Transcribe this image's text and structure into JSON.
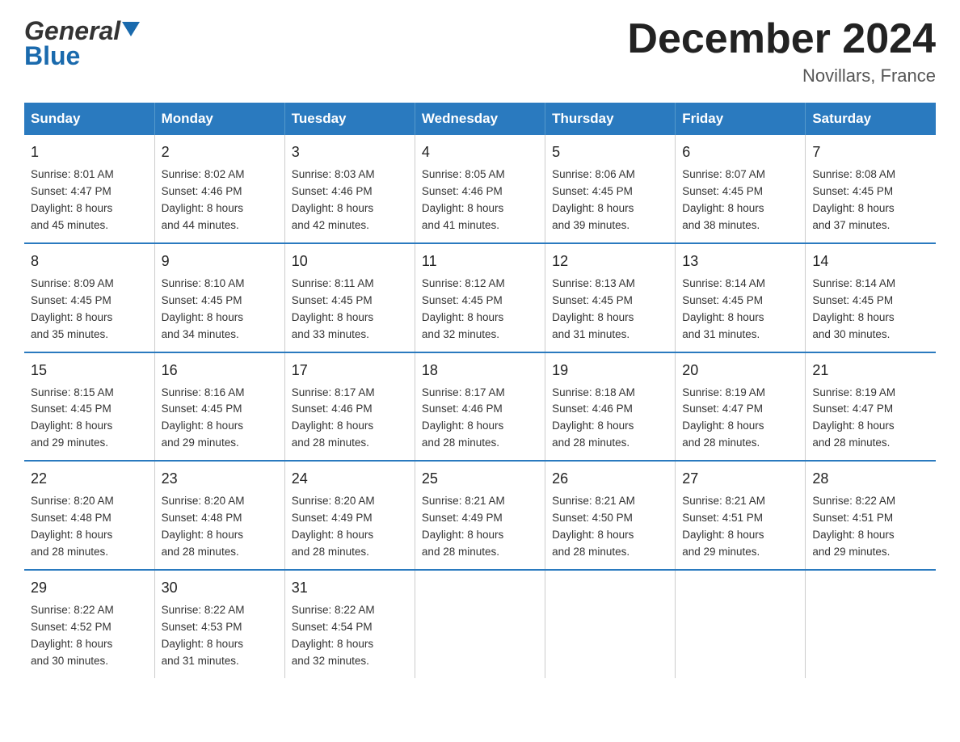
{
  "header": {
    "logo_line1": "General",
    "logo_line2": "Blue",
    "main_title": "December 2024",
    "subtitle": "Novillars, France"
  },
  "days_of_week": [
    "Sunday",
    "Monday",
    "Tuesday",
    "Wednesday",
    "Thursday",
    "Friday",
    "Saturday"
  ],
  "weeks": [
    [
      {
        "day": "1",
        "sunrise": "8:01 AM",
        "sunset": "4:47 PM",
        "daylight": "8 hours and 45 minutes."
      },
      {
        "day": "2",
        "sunrise": "8:02 AM",
        "sunset": "4:46 PM",
        "daylight": "8 hours and 44 minutes."
      },
      {
        "day": "3",
        "sunrise": "8:03 AM",
        "sunset": "4:46 PM",
        "daylight": "8 hours and 42 minutes."
      },
      {
        "day": "4",
        "sunrise": "8:05 AM",
        "sunset": "4:46 PM",
        "daylight": "8 hours and 41 minutes."
      },
      {
        "day": "5",
        "sunrise": "8:06 AM",
        "sunset": "4:45 PM",
        "daylight": "8 hours and 39 minutes."
      },
      {
        "day": "6",
        "sunrise": "8:07 AM",
        "sunset": "4:45 PM",
        "daylight": "8 hours and 38 minutes."
      },
      {
        "day": "7",
        "sunrise": "8:08 AM",
        "sunset": "4:45 PM",
        "daylight": "8 hours and 37 minutes."
      }
    ],
    [
      {
        "day": "8",
        "sunrise": "8:09 AM",
        "sunset": "4:45 PM",
        "daylight": "8 hours and 35 minutes."
      },
      {
        "day": "9",
        "sunrise": "8:10 AM",
        "sunset": "4:45 PM",
        "daylight": "8 hours and 34 minutes."
      },
      {
        "day": "10",
        "sunrise": "8:11 AM",
        "sunset": "4:45 PM",
        "daylight": "8 hours and 33 minutes."
      },
      {
        "day": "11",
        "sunrise": "8:12 AM",
        "sunset": "4:45 PM",
        "daylight": "8 hours and 32 minutes."
      },
      {
        "day": "12",
        "sunrise": "8:13 AM",
        "sunset": "4:45 PM",
        "daylight": "8 hours and 31 minutes."
      },
      {
        "day": "13",
        "sunrise": "8:14 AM",
        "sunset": "4:45 PM",
        "daylight": "8 hours and 31 minutes."
      },
      {
        "day": "14",
        "sunrise": "8:14 AM",
        "sunset": "4:45 PM",
        "daylight": "8 hours and 30 minutes."
      }
    ],
    [
      {
        "day": "15",
        "sunrise": "8:15 AM",
        "sunset": "4:45 PM",
        "daylight": "8 hours and 29 minutes."
      },
      {
        "day": "16",
        "sunrise": "8:16 AM",
        "sunset": "4:45 PM",
        "daylight": "8 hours and 29 minutes."
      },
      {
        "day": "17",
        "sunrise": "8:17 AM",
        "sunset": "4:46 PM",
        "daylight": "8 hours and 28 minutes."
      },
      {
        "day": "18",
        "sunrise": "8:17 AM",
        "sunset": "4:46 PM",
        "daylight": "8 hours and 28 minutes."
      },
      {
        "day": "19",
        "sunrise": "8:18 AM",
        "sunset": "4:46 PM",
        "daylight": "8 hours and 28 minutes."
      },
      {
        "day": "20",
        "sunrise": "8:19 AM",
        "sunset": "4:47 PM",
        "daylight": "8 hours and 28 minutes."
      },
      {
        "day": "21",
        "sunrise": "8:19 AM",
        "sunset": "4:47 PM",
        "daylight": "8 hours and 28 minutes."
      }
    ],
    [
      {
        "day": "22",
        "sunrise": "8:20 AM",
        "sunset": "4:48 PM",
        "daylight": "8 hours and 28 minutes."
      },
      {
        "day": "23",
        "sunrise": "8:20 AM",
        "sunset": "4:48 PM",
        "daylight": "8 hours and 28 minutes."
      },
      {
        "day": "24",
        "sunrise": "8:20 AM",
        "sunset": "4:49 PM",
        "daylight": "8 hours and 28 minutes."
      },
      {
        "day": "25",
        "sunrise": "8:21 AM",
        "sunset": "4:49 PM",
        "daylight": "8 hours and 28 minutes."
      },
      {
        "day": "26",
        "sunrise": "8:21 AM",
        "sunset": "4:50 PM",
        "daylight": "8 hours and 28 minutes."
      },
      {
        "day": "27",
        "sunrise": "8:21 AM",
        "sunset": "4:51 PM",
        "daylight": "8 hours and 29 minutes."
      },
      {
        "day": "28",
        "sunrise": "8:22 AM",
        "sunset": "4:51 PM",
        "daylight": "8 hours and 29 minutes."
      }
    ],
    [
      {
        "day": "29",
        "sunrise": "8:22 AM",
        "sunset": "4:52 PM",
        "daylight": "8 hours and 30 minutes."
      },
      {
        "day": "30",
        "sunrise": "8:22 AM",
        "sunset": "4:53 PM",
        "daylight": "8 hours and 31 minutes."
      },
      {
        "day": "31",
        "sunrise": "8:22 AM",
        "sunset": "4:54 PM",
        "daylight": "8 hours and 32 minutes."
      },
      null,
      null,
      null,
      null
    ]
  ],
  "labels": {
    "sunrise": "Sunrise:",
    "sunset": "Sunset:",
    "daylight": "Daylight:"
  }
}
